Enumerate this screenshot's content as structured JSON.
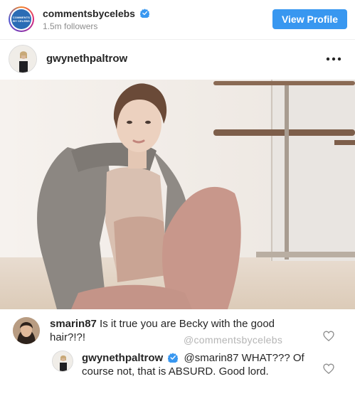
{
  "account": {
    "username": "commentsbycelebs",
    "followers": "1.5m followers",
    "logo_text_line1": "COMMENTS",
    "logo_text_line2": "BY CELEBS",
    "view_profile_label": "View Profile"
  },
  "post": {
    "author": "gwynethpaltrow",
    "more_icon": "more-horizontal-icon"
  },
  "comments": [
    {
      "username": "smarin87",
      "text": "Is it true you are Becky with the good hair?!?!",
      "watermark": "@commentsbycelebs"
    },
    {
      "username": "gwynethpaltrow",
      "mention": "@smarin87",
      "text": "WHAT??? Of course not, that is ABSURD. Good lord."
    }
  ],
  "colors": {
    "brand_button": "#3897f0",
    "verified_badge": "#3897f0",
    "text": "#262626",
    "secondary_text": "#8e8e8e"
  }
}
